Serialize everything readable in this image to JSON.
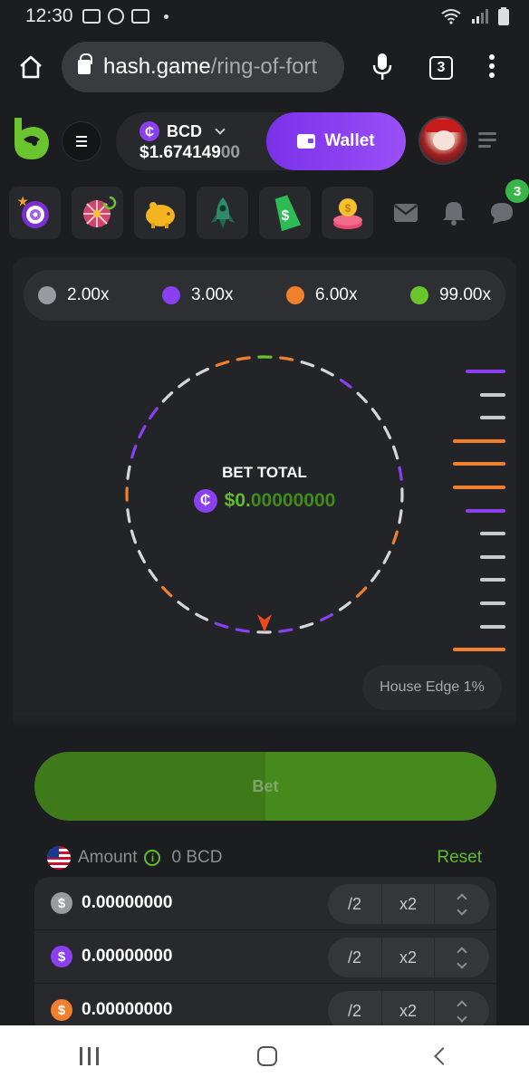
{
  "status_bar": {
    "time": "12:30"
  },
  "browser": {
    "url_host": "hash.game",
    "url_path": "/ring-of-fort",
    "tab_count": "3"
  },
  "header": {
    "currency": "BCD",
    "currency_symbol": "₵",
    "balance_main": "$1.674149",
    "balance_dim": "00",
    "wallet_label": "Wallet"
  },
  "quick_icons": {
    "notification_badge": "3",
    "icons": [
      "target-icon",
      "spin-wheel-icon",
      "piggy-bank-icon",
      "rocket-icon",
      "dollar-tag-icon",
      "coin-stack-icon",
      "mail-icon",
      "bell-icon",
      "chat-icon"
    ]
  },
  "game": {
    "payouts": [
      {
        "label": "2.00x",
        "color": "#9a9ba0"
      },
      {
        "label": "3.00x",
        "color": "#8a3ff0"
      },
      {
        "label": "6.00x",
        "color": "#f0802c"
      },
      {
        "label": "99.00x",
        "color": "#6ac42e"
      }
    ],
    "bet_total_label": "BET TOTAL",
    "bet_total_main": "$0.",
    "bet_total_dim": "00000000",
    "house_edge": "House Edge 1%",
    "history_colors": [
      "#8a3ff0",
      "#c9cacd",
      "#c9cacd",
      "#f0802c",
      "#f0802c",
      "#f0802c",
      "#8a3ff0",
      "#c9cacd",
      "#c9cacd",
      "#c9cacd",
      "#c9cacd",
      "#c9cacd",
      "#f0802c"
    ]
  },
  "bet": {
    "button_label": "Bet",
    "amount_label": "Amount",
    "amount_value": "0 BCD",
    "reset_label": "Reset",
    "rows": [
      {
        "symbol": "$",
        "color": "#9a9ba0",
        "value": "0.00000000",
        "half": "/2",
        "double": "x2"
      },
      {
        "symbol": "$",
        "color": "#8a3ff0",
        "value": "0.00000000",
        "half": "/2",
        "double": "x2"
      },
      {
        "symbol": "$",
        "color": "#f0802c",
        "value": "0.00000000",
        "half": "/2",
        "double": "x2"
      }
    ]
  }
}
